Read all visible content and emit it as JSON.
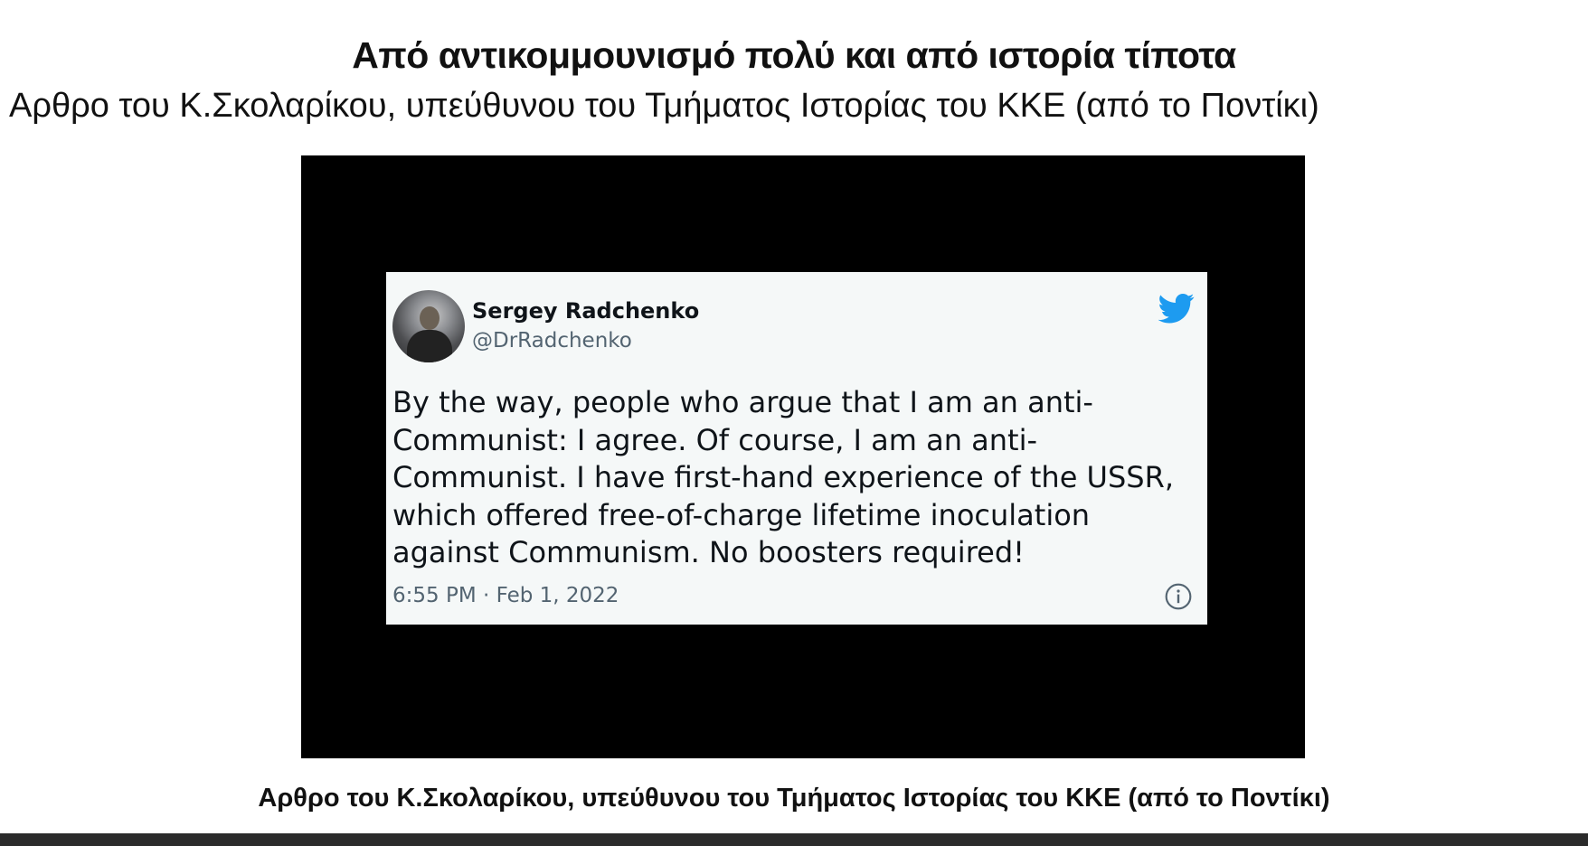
{
  "article": {
    "headline": "Από αντικομμουνισμό πολύ και από ιστορία τίποτα",
    "subtitle": "Αρθρο του Κ.Σκολαρίκου, υπεύθυνου του Τμήματος Ιστορίας του ΚΚΕ (από το Ποντίκι)",
    "caption": "Αρθρο του Κ.Σκολαρίκου, υπεύθυνου του Τμήματος Ιστορίας του ΚΚΕ (από το Ποντίκι)"
  },
  "tweet": {
    "author_name": "Sergey Radchenko",
    "author_handle": "@DrRadchenko",
    "text": "By the way, people who argue that I am an anti-Communist: I agree. Of course, I am an anti-Communist. I have first-hand experience of the USSR, which offered free-of-charge lifetime inoculation against Communism. No boosters required!",
    "timestamp": "6:55 PM · Feb 1, 2022",
    "brand_icon": "twitter-bird-icon",
    "brand_color": "#1d9bf0",
    "info_icon": "info-icon"
  },
  "colors": {
    "video_background": "#000000",
    "tweet_background": "#f5f8f8",
    "handle_gray": "#536471",
    "bottom_bar": "#2b2b2b"
  }
}
